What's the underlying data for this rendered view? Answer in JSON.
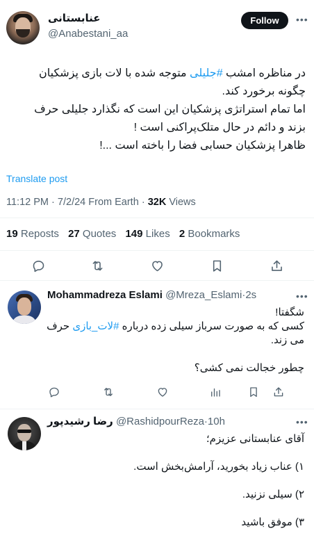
{
  "tweet": {
    "author_name": "عنابستانی",
    "author_handle": "@Anabestani_aa",
    "follow_label": "Follow",
    "text_line1_before": "در مناظره امشب ",
    "text_hashtag": "#جلیلی",
    "text_line1_after": " متوجه شده با لات بازی پزشکیان",
    "text_line2": "چگونه برخورد کند.",
    "text_line3": "اما تمام استراتژی پزشکیان این است که نگذارد جلیلی حرف",
    "text_line4": "بزند و دائم در حال متلک‌پراکنی است !",
    "text_line5": "ظاهرا پزشکیان حسابی فضا را باخته است ...!",
    "translate_label": "Translate post",
    "time": "11:12 PM",
    "date": "7/2/24",
    "source": "From Earth",
    "views_count": "32K",
    "views_label": "Views",
    "reposts_count": "19",
    "reposts_label": "Reposts",
    "quotes_count": "27",
    "quotes_label": "Quotes",
    "likes_count": "149",
    "likes_label": "Likes",
    "bookmarks_count": "2",
    "bookmarks_label": "Bookmarks"
  },
  "replies": [
    {
      "author_name": "Mohammadreza Eslami",
      "author_handle": "@Mreza_Eslami",
      "age": "2s",
      "line1": "شگفتا!",
      "line2_before": "کسی که به صورت سرباز سیلی زده درباره ",
      "line2_hashtag": "#لات_بازی",
      "line2_after": " حرف",
      "line3": "می زند.",
      "line4": "چطور خجالت نمی کشی؟"
    },
    {
      "author_name": "رضا رشیدپور",
      "author_handle": "@RashidpourReza",
      "age": "10h",
      "line1": "آقای عنابستانی عزیزم؛",
      "line2": "۱) عناب زیاد بخورید، آرامش‌بخش است.",
      "line3": "۲) سیلی نزنید.",
      "line4": "۳) موفق باشید"
    }
  ],
  "separator": "·",
  "icons": [
    "more-icon",
    "reply-icon",
    "repost-icon",
    "like-icon",
    "bookmark-icon",
    "share-icon",
    "views-icon"
  ],
  "colors": {
    "accent": "#1d9bf0",
    "text": "#0f1419",
    "muted": "#536471"
  }
}
